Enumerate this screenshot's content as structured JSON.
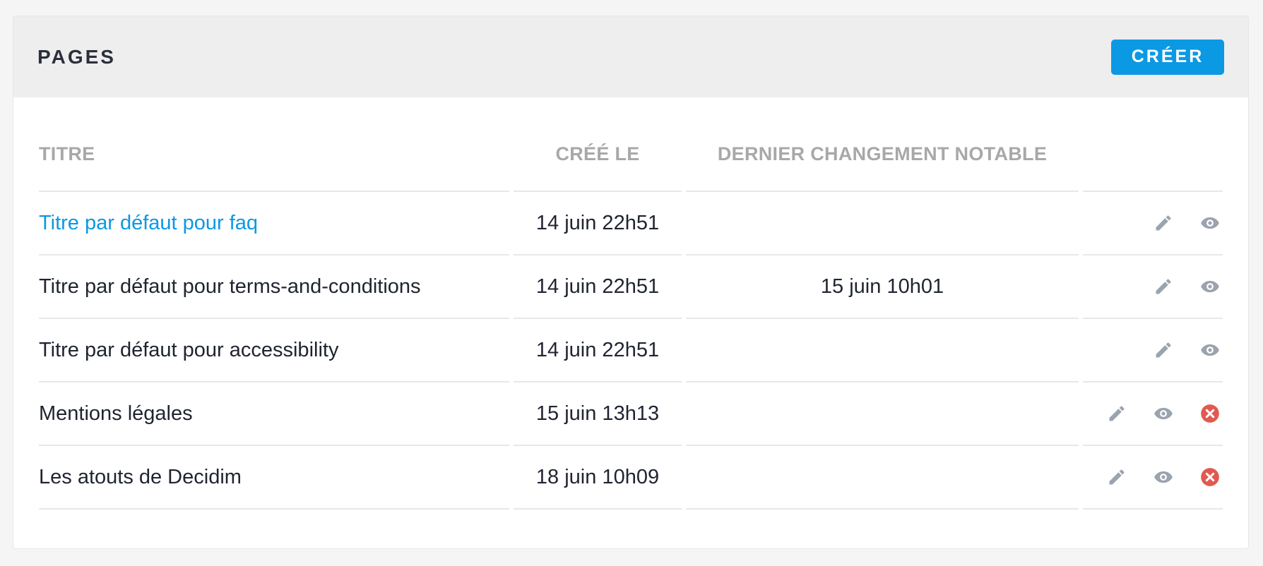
{
  "header": {
    "title": "PAGES",
    "create_label": "CRÉER"
  },
  "table": {
    "columns": [
      "TITRE",
      "CRÉÉ LE",
      "DERNIER CHANGEMENT NOTABLE"
    ],
    "rows": [
      {
        "title": "Titre par défaut pour faq",
        "created": "14 juin 22h51",
        "changed": "",
        "is_link": true,
        "deletable": false
      },
      {
        "title": "Titre par défaut pour terms-and-conditions",
        "created": "14 juin 22h51",
        "changed": "15 juin 10h01",
        "is_link": false,
        "deletable": false
      },
      {
        "title": "Titre par défaut pour accessibility",
        "created": "14 juin 22h51",
        "changed": "",
        "is_link": false,
        "deletable": false
      },
      {
        "title": "Mentions légales",
        "created": "15 juin 13h13",
        "changed": "",
        "is_link": false,
        "deletable": true
      },
      {
        "title": "Les atouts de Decidim",
        "created": "18 juin 10h09",
        "changed": "",
        "is_link": false,
        "deletable": true
      }
    ]
  },
  "icons": {
    "edit": "pencil-icon",
    "preview": "eye-icon",
    "delete": "circle-x-icon"
  },
  "colors": {
    "accent": "#0b99e3",
    "icon_gray": "#9aa3ae",
    "danger": "#e05a4f"
  }
}
